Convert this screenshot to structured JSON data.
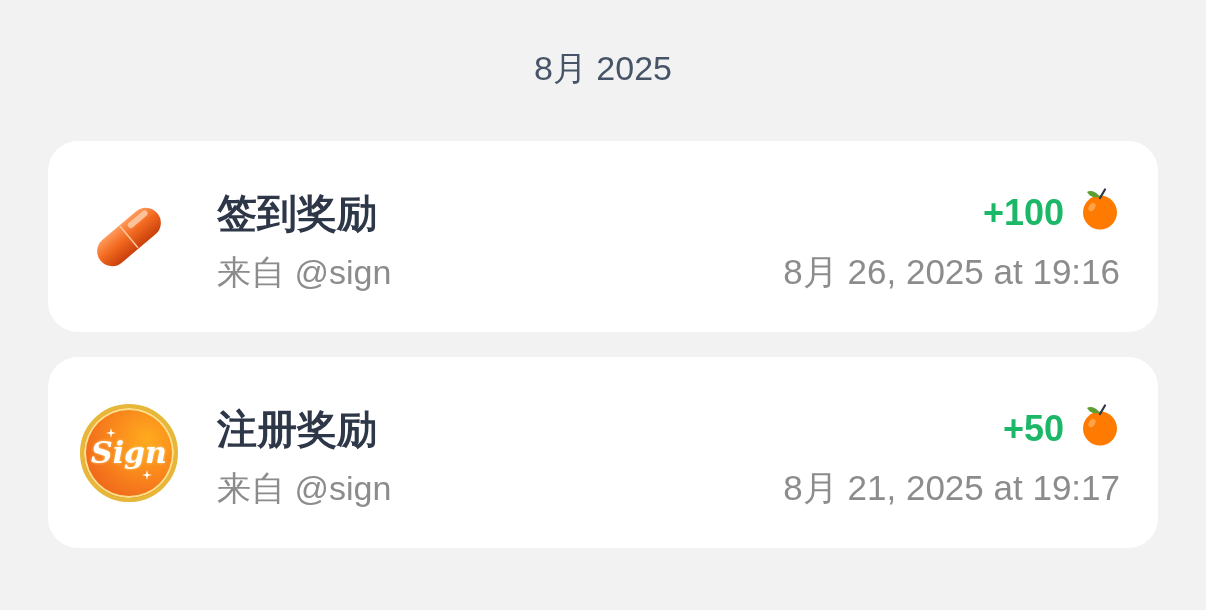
{
  "month": "8月 2025",
  "records": [
    {
      "icon": {
        "kind": "capsule"
      },
      "title": "签到奖励",
      "source": "来自 @sign",
      "amount": "+100",
      "date": "8月 26, 2025 at 19:16"
    },
    {
      "icon": {
        "kind": "coin",
        "text": "Sign"
      },
      "title": "注册奖励",
      "source": "来自 @sign",
      "amount": "+50",
      "date": "8月 21, 2025 at 19:17"
    }
  ]
}
